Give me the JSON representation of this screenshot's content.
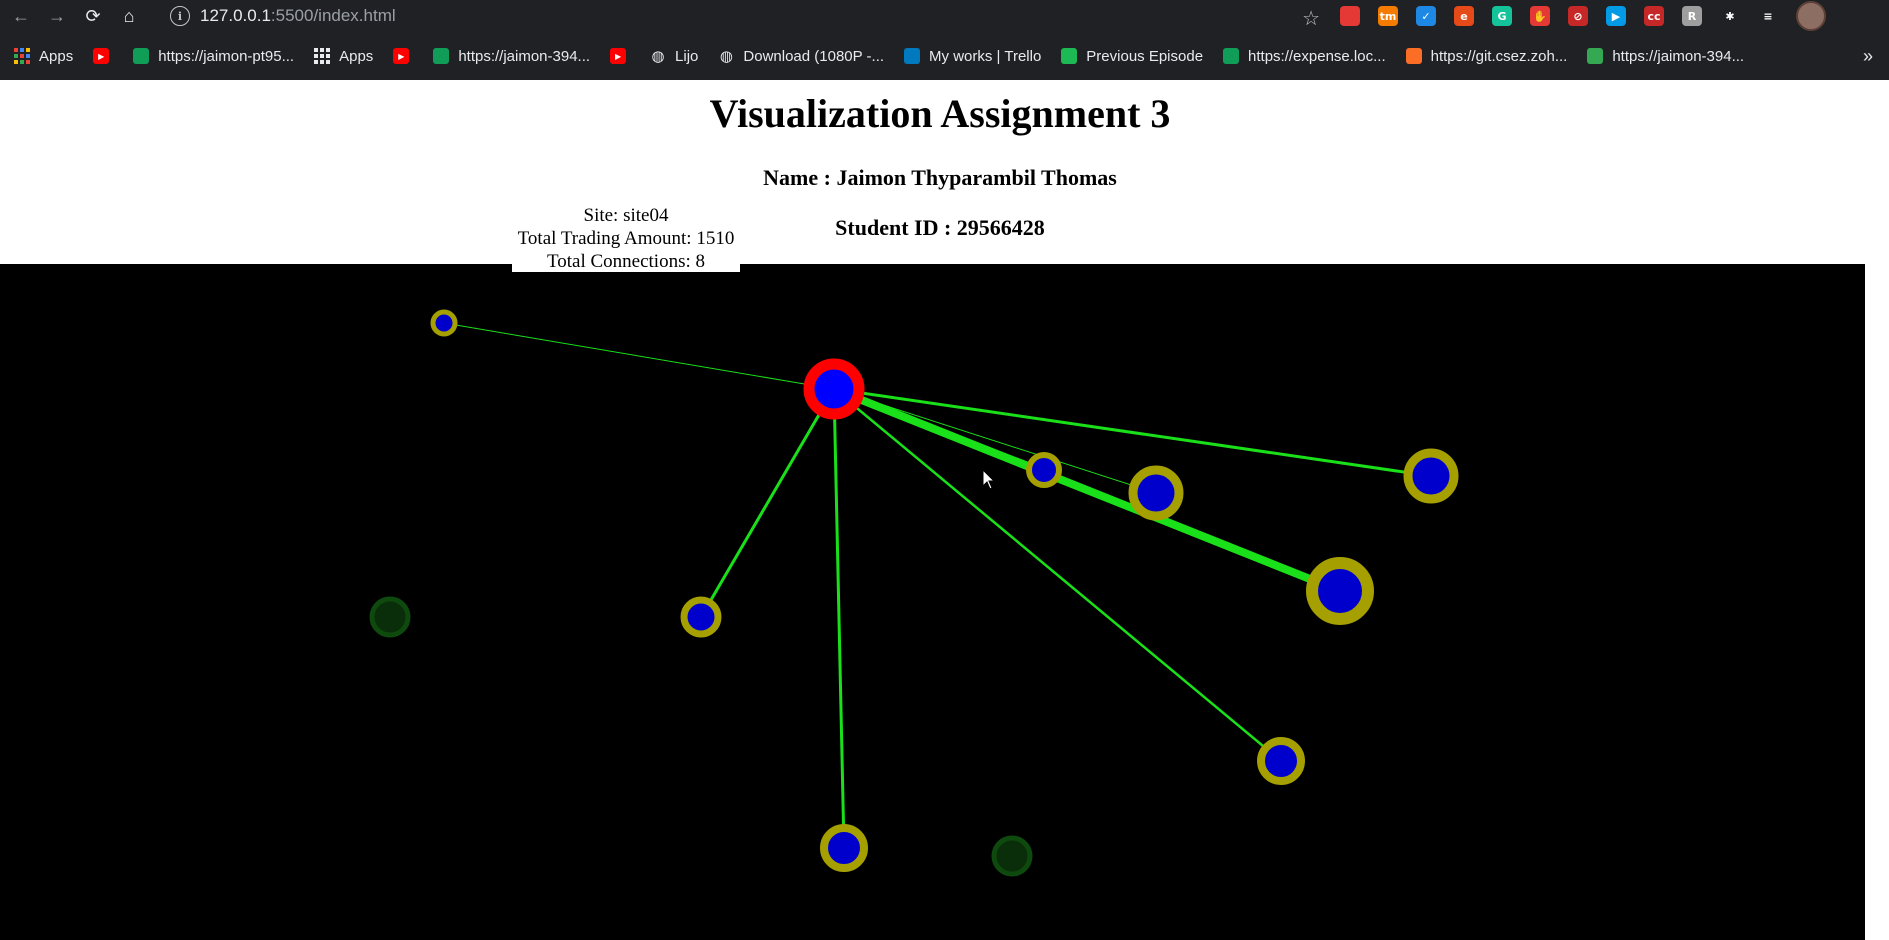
{
  "browser": {
    "url_host": "127.0.0.1",
    "url_rest": ":5500/index.html",
    "extensions": [
      {
        "icon": "rocket-extension-icon",
        "color": "#e53935",
        "text": ""
      },
      {
        "icon": "tm-extension-icon",
        "color": "#f57c00",
        "text": "tm"
      },
      {
        "icon": "check-extension-icon",
        "color": "#1e88e5",
        "text": "✓"
      },
      {
        "icon": "e-extension-icon",
        "color": "#e64a19",
        "text": "e"
      },
      {
        "icon": "grammarly-icon",
        "color": "#15c39a",
        "text": "G"
      },
      {
        "icon": "hand-extension-icon",
        "color": "#e53935",
        "text": "✋"
      },
      {
        "icon": "blocker-extension-icon",
        "color": "#c62828",
        "text": "⊘"
      },
      {
        "icon": "tab-extension-icon",
        "color": "#039be5",
        "text": "▶"
      },
      {
        "icon": "cc-extension-icon",
        "color": "#c62828",
        "text": "cc"
      },
      {
        "icon": "r-extension-icon",
        "color": "#9e9e9e",
        "text": "R"
      },
      {
        "icon": "puzzle-icon",
        "color": "transparent",
        "text": "✱"
      },
      {
        "icon": "playlist-icon",
        "color": "transparent",
        "text": "≡"
      }
    ]
  },
  "bookmarks": [
    {
      "label": "Apps",
      "icon": "apps-grid-icon-color"
    },
    {
      "label": "",
      "icon": "youtube-icon"
    },
    {
      "label": "https://jaimon-pt95...",
      "icon": "sheet-icon"
    },
    {
      "label": "Apps",
      "icon": "apps-grid-icon-white"
    },
    {
      "label": "",
      "icon": "youtube-icon"
    },
    {
      "label": "https://jaimon-394...",
      "icon": "sheet-icon"
    },
    {
      "label": "",
      "icon": "youtube-icon"
    },
    {
      "label": "Lijo",
      "icon": "globe-icon"
    },
    {
      "label": "Download (1080P -...",
      "icon": "globe-icon"
    },
    {
      "label": "My works | Trello",
      "icon": "trello-icon"
    },
    {
      "label": "Previous Episode",
      "icon": "green-leaf-icon"
    },
    {
      "label": "https://expense.loc...",
      "icon": "sheet-icon"
    },
    {
      "label": "https://git.csez.zoh...",
      "icon": "gitlab-icon"
    },
    {
      "label": "https://jaimon-394...",
      "icon": "s-sheet-icon"
    }
  ],
  "page": {
    "title": "Visualization Assignment 3",
    "name_line": "Name : Jaimon Thyparambil Thomas",
    "id_line": "Student ID : 29566428"
  },
  "tooltip": {
    "site": "Site: site04",
    "amount": "Total Trading Amount: 1510",
    "connections": "Total Connections: 8"
  },
  "graph": {
    "selected_color": "#ff0000",
    "connected_color": "#a5a000",
    "faded_color": "#0a3a0a",
    "node_fill": "#0000ee",
    "edge_color": "#1ae01a"
  }
}
